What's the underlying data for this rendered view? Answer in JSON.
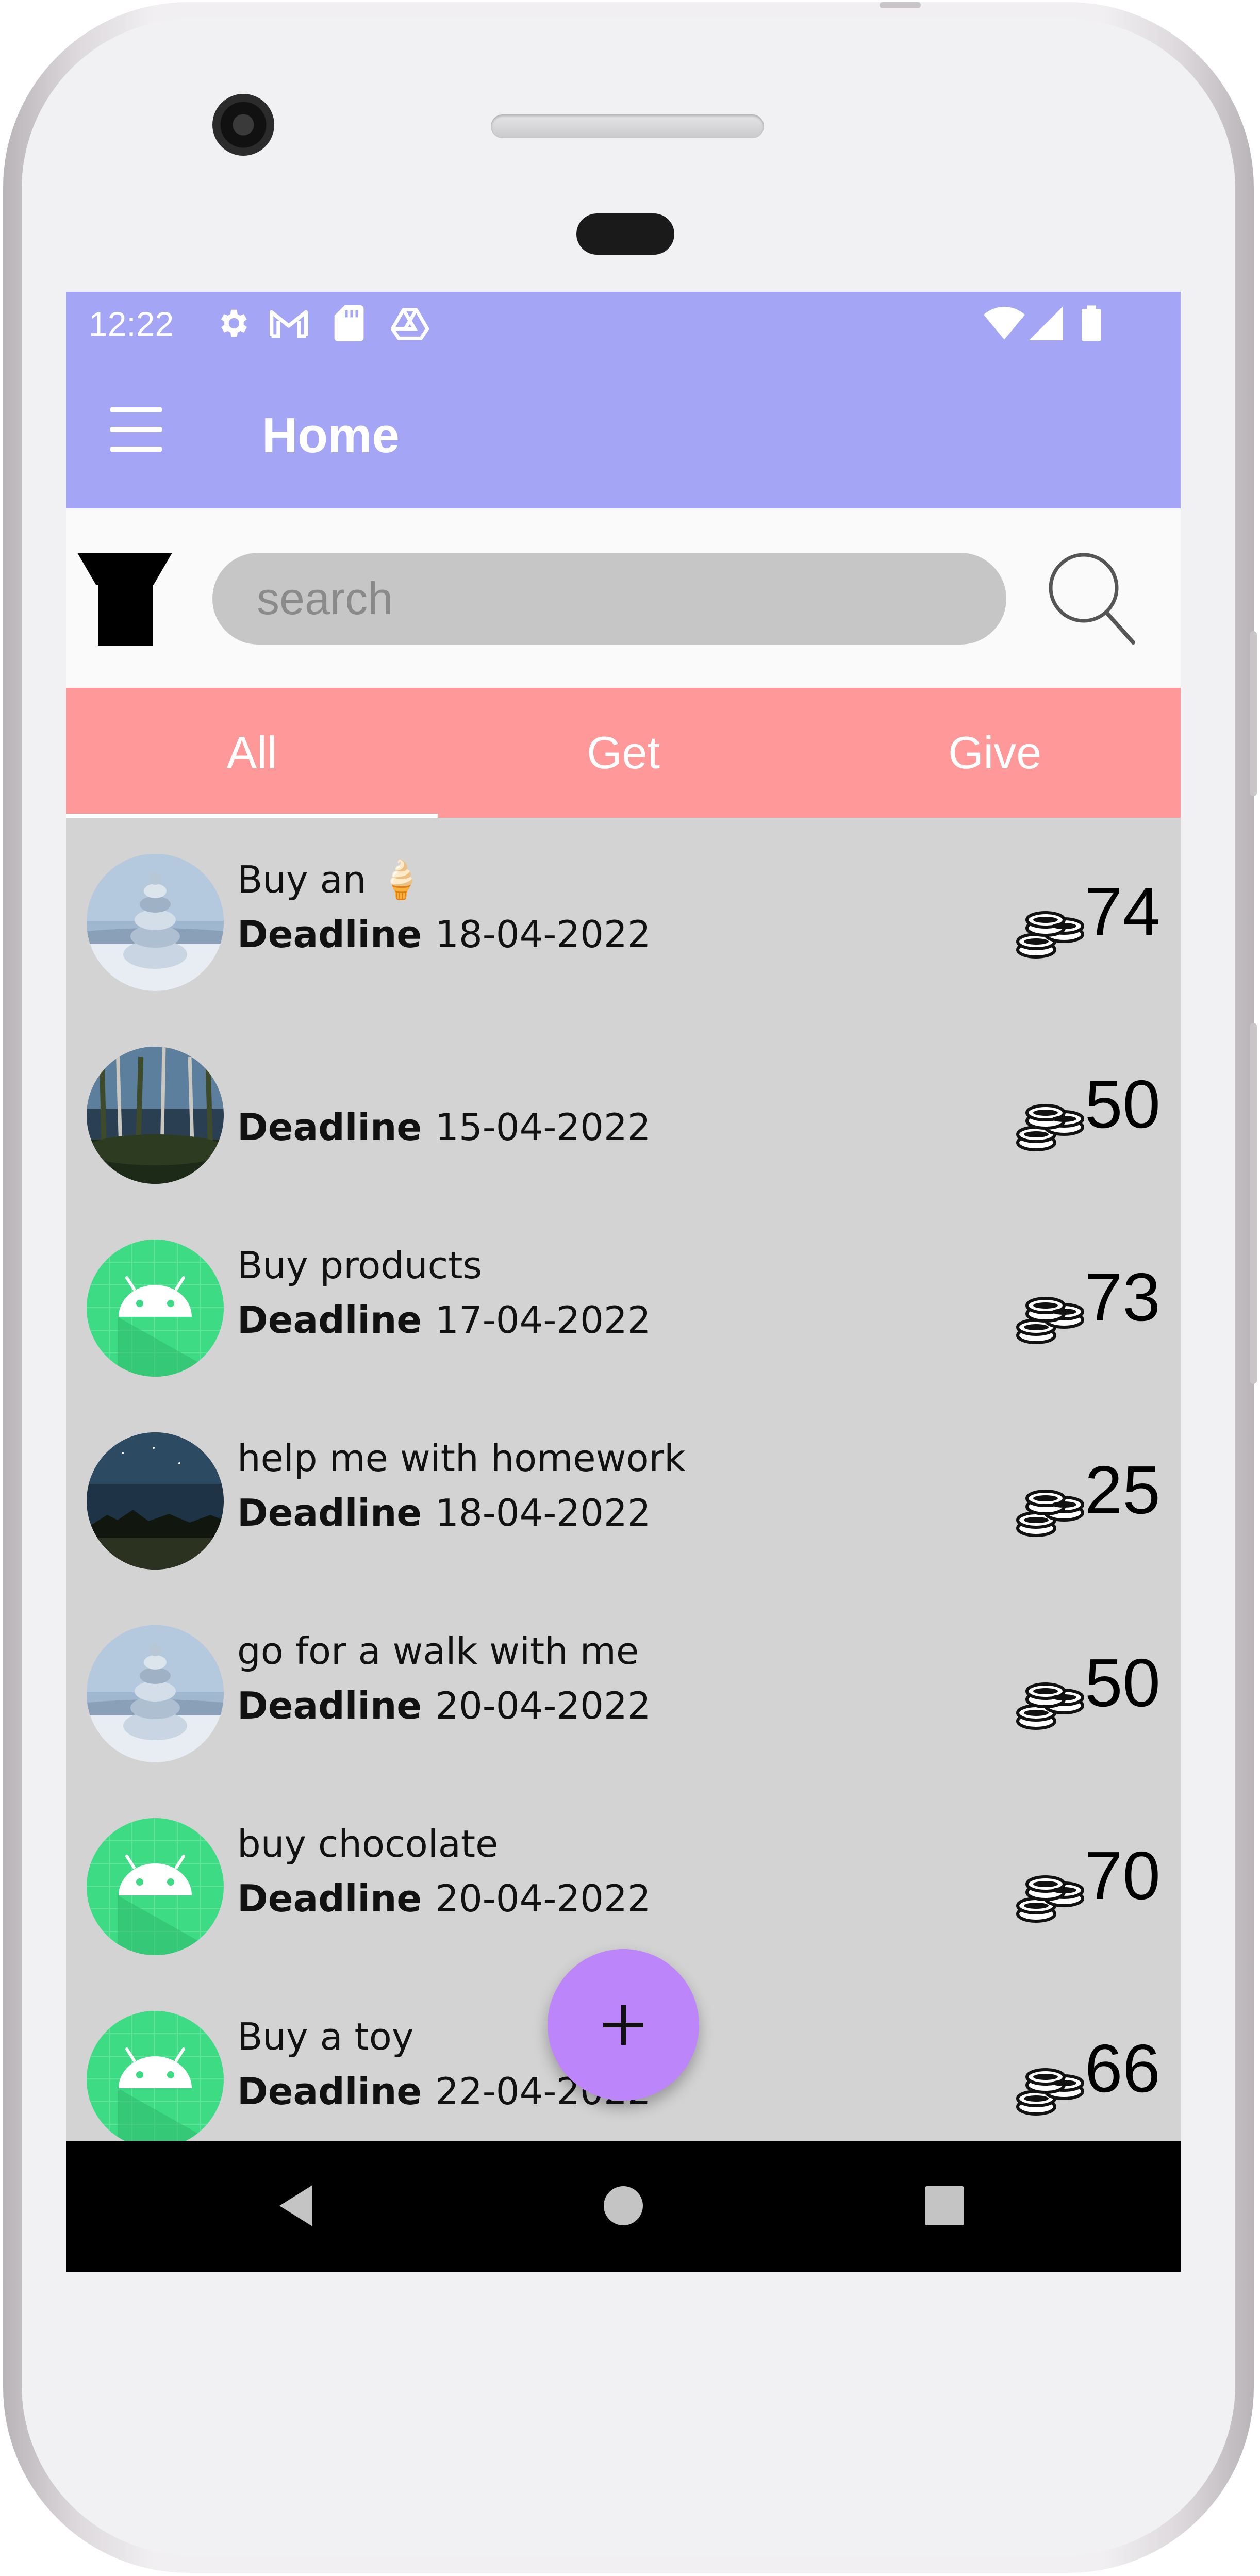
{
  "status_bar": {
    "time": "12:22",
    "left_icons": [
      "gear-icon",
      "gmail-icon",
      "sd-card-icon",
      "drive-icon"
    ],
    "right_icons": [
      "wifi-icon",
      "signal-icon",
      "battery-icon"
    ]
  },
  "app_bar": {
    "title": "Home",
    "color": "#a5a5f5"
  },
  "search": {
    "placeholder": "search",
    "value": ""
  },
  "tabs": [
    {
      "label": "All",
      "selected": true
    },
    {
      "label": "Get",
      "selected": false
    },
    {
      "label": "Give",
      "selected": false
    }
  ],
  "tasks": [
    {
      "title": "Buy an 🍦",
      "deadline_label": "Deadline",
      "deadline": "18-04-2022",
      "amount": "74",
      "avatar": "ice-stack-photo"
    },
    {
      "title": "",
      "deadline_label": "Deadline",
      "deadline": "15-04-2022",
      "amount": "50",
      "avatar": "forest-photo"
    },
    {
      "title": "Buy products",
      "deadline_label": "Deadline",
      "deadline": "17-04-2022",
      "amount": "73",
      "avatar": "android-icon"
    },
    {
      "title": "help me with homework",
      "deadline_label": "Deadline",
      "deadline": "18-04-2022",
      "amount": "25",
      "avatar": "night-sky-photo"
    },
    {
      "title": "go for a walk with me",
      "deadline_label": "Deadline",
      "deadline": "20-04-2022",
      "amount": "50",
      "avatar": "ice-stack-photo"
    },
    {
      "title": "buy chocolate",
      "deadline_label": "Deadline",
      "deadline": "20-04-2022",
      "amount": "70",
      "avatar": "android-icon"
    },
    {
      "title": "Buy a toy",
      "deadline_label": "Deadline",
      "deadline": "22-04-2022",
      "amount": "66",
      "avatar": "android-icon"
    }
  ],
  "fab": {
    "icon": "plus-icon",
    "color": "#bd85fa"
  },
  "nav_bar": {
    "icons": [
      "back-icon",
      "home-icon",
      "recents-icon"
    ]
  },
  "colors": {
    "tabs": "#ff9999",
    "list_bg": "#d3d3d3"
  }
}
